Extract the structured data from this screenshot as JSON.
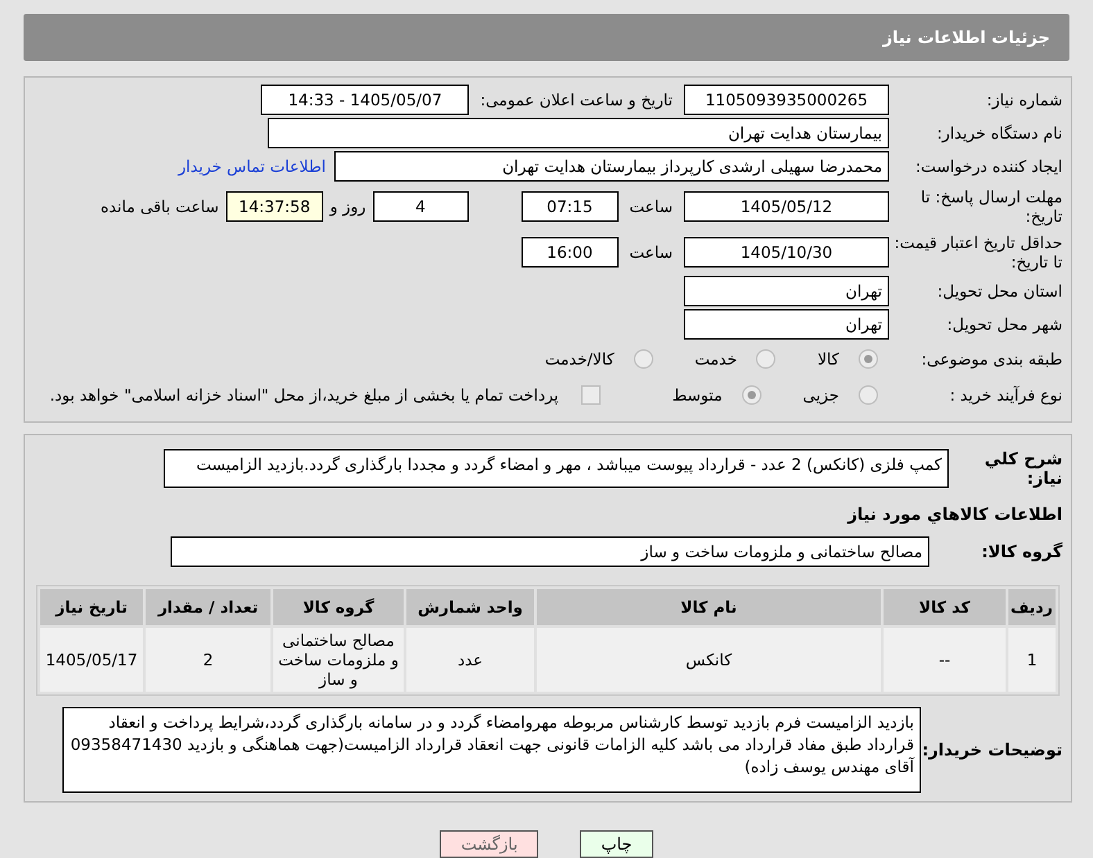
{
  "header": {
    "title": "جزئیات اطلاعات نیاز"
  },
  "need_number": {
    "label": "شماره نیاز:",
    "value": "1105093935000265"
  },
  "announce": {
    "label": "تاریخ و ساعت اعلان عمومی:",
    "value": "1405/05/07 - 14:33"
  },
  "buyer": {
    "label": "نام دستگاه خریدار:",
    "value": "بیمارستان هدایت تهران"
  },
  "creator": {
    "label": "ایجاد کننده درخواست:",
    "value": "محمدرضا سهیلی ارشدی کارپرداز بیمارستان هدایت تهران",
    "link": "اطلاعات تماس خریدار"
  },
  "deadline": {
    "label": "مهلت ارسال پاسخ: تا تاریخ:",
    "date": "1405/05/12",
    "time_label": "ساعت",
    "time": "07:15",
    "days": "4",
    "days_label": "روز و",
    "remaining": "14:37:58",
    "remaining_label": "ساعت باقی مانده"
  },
  "validity": {
    "label": "حداقل تاریخ اعتبار قیمت: تا تاریخ:",
    "date": "1405/10/30",
    "time_label": "ساعت",
    "time": "16:00"
  },
  "province": {
    "label": "استان محل تحویل:",
    "value": "تهران"
  },
  "city": {
    "label": "شهر محل تحویل:",
    "value": "تهران"
  },
  "category": {
    "label": "طبقه بندی موضوعی:",
    "options": [
      {
        "label": "کالا",
        "selected": true
      },
      {
        "label": "خدمت",
        "selected": false
      },
      {
        "label": "کالا/خدمت",
        "selected": false
      }
    ]
  },
  "process": {
    "label": "نوع فرآیند خرید :",
    "options": [
      {
        "label": "جزیی",
        "selected": false
      },
      {
        "label": "متوسط",
        "selected": true
      }
    ],
    "treasury": {
      "label": "پرداخت تمام یا بخشی از مبلغ خرید،از محل \"اسناد خزانه اسلامی\" خواهد بود.",
      "checked": false
    }
  },
  "summary": {
    "label": "شرح کلي نياز:",
    "value": "کمپ فلزی (کانکس) 2 عدد - قرارداد پیوست میباشد ، مهر و امضاء گردد و مجددا بارگذاری گردد.بازدید الزامیست"
  },
  "goods_heading": "اطلاعات کالاهاي مورد نياز",
  "goods_group": {
    "label": "گروه کالا:",
    "value": "مصالح ساختمانی و ملزومات ساخت و ساز"
  },
  "table": {
    "columns": [
      "ردیف",
      "کد کالا",
      "نام کالا",
      "واحد شمارش",
      "گروه کالا",
      "تعداد / مقدار",
      "تاریخ نیاز"
    ],
    "rows": [
      [
        "1",
        "--",
        "کانکس",
        "عدد",
        "مصالح ساختمانی و ملزومات ساخت و ساز",
        "2",
        "1405/05/17"
      ]
    ]
  },
  "notes": {
    "label": "توضیحات خریدار:",
    "value": "بازدید الزامیست فرم بازدید توسط کارشناس مربوطه مهروامضاء گردد و در سامانه بارگذاری گردد،شرایط پرداخت و انعقاد قرارداد طبق مفاد قرارداد می باشد کلیه الزامات قانونی جهت انعقاد قرارداد الزامیست(جهت هماهنگی و بازدید 09358471430 آقای مهندس یوسف زاده)"
  },
  "buttons": [
    {
      "label": "چاپ",
      "kind": "print"
    },
    {
      "label": "بازگشت",
      "kind": "back"
    }
  ]
}
